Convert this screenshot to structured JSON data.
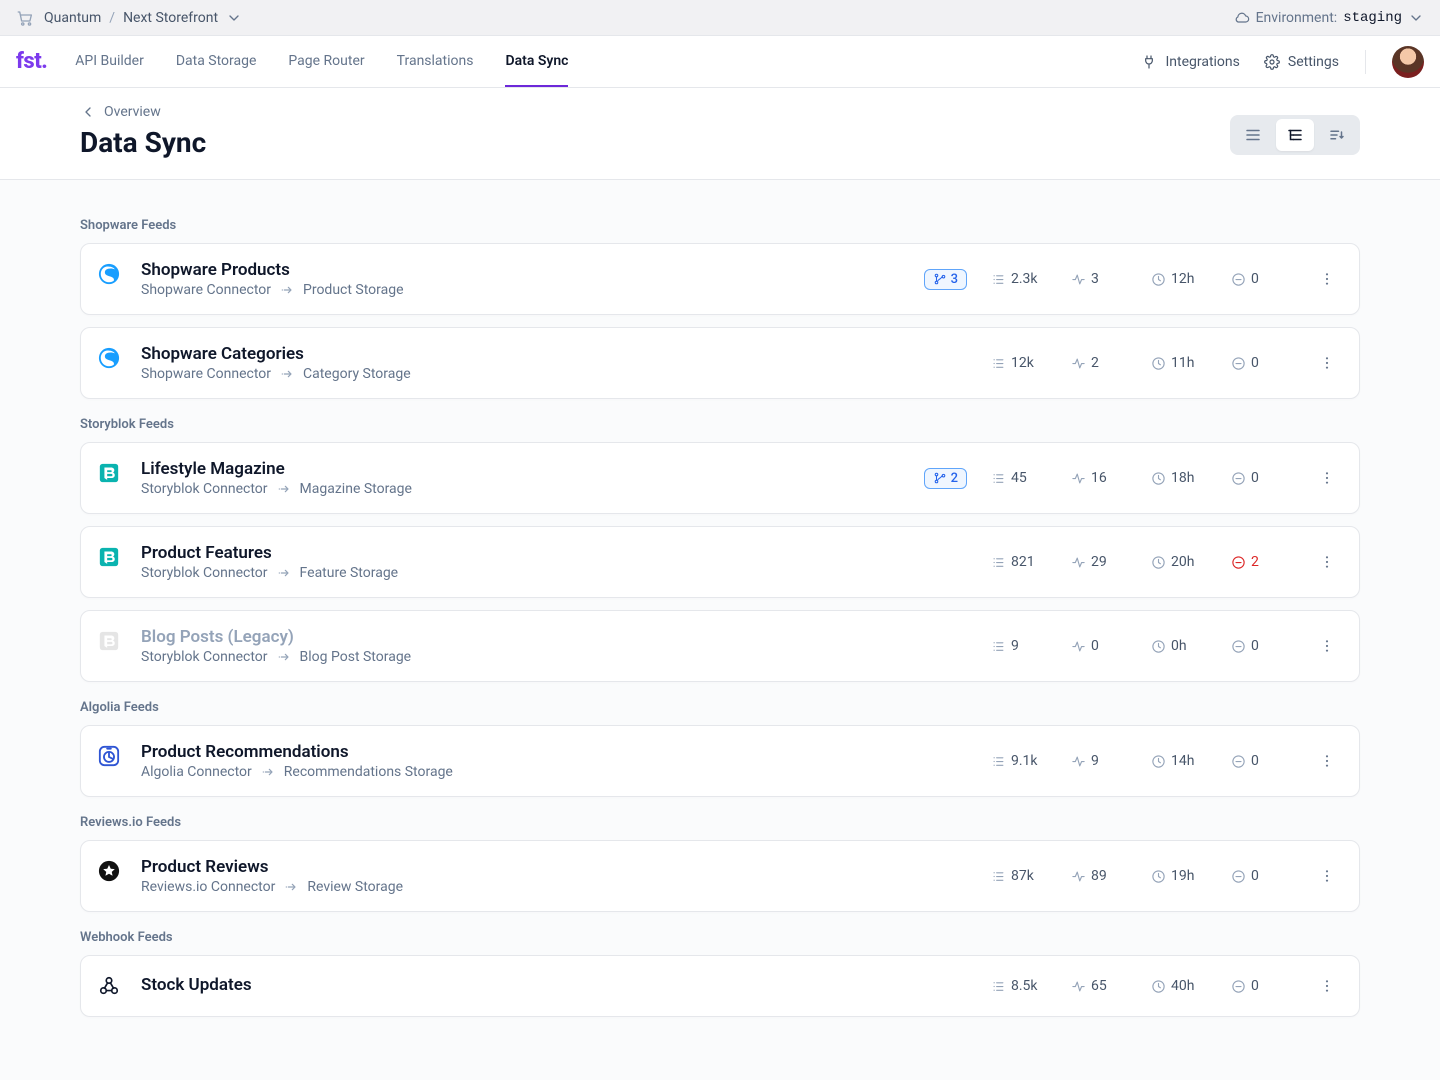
{
  "topbar": {
    "workspace": "Quantum",
    "project": "Next Storefront",
    "env_label": "Environment:",
    "env_value": "staging"
  },
  "nav": {
    "tabs": [
      "API Builder",
      "Data Storage",
      "Page Router",
      "Translations",
      "Data Sync"
    ],
    "active": 4,
    "integrations": "Integrations",
    "settings": "Settings"
  },
  "page": {
    "breadcrumb": "Overview",
    "title": "Data Sync"
  },
  "groups": [
    {
      "title": "Shopware Feeds",
      "items": [
        {
          "icon": "shopware",
          "title": "Shopware Products",
          "src": "Shopware Connector",
          "dst": "Product Storage",
          "badge": "3",
          "records": "2.3k",
          "activity": "3",
          "age": "12h",
          "errors": "0"
        },
        {
          "icon": "shopware",
          "title": "Shopware Categories",
          "src": "Shopware Connector",
          "dst": "Category Storage",
          "badge": null,
          "records": "12k",
          "activity": "2",
          "age": "11h",
          "errors": "0"
        }
      ]
    },
    {
      "title": "Storyblok Feeds",
      "items": [
        {
          "icon": "storyblok",
          "title": "Lifestyle Magazine",
          "src": "Storyblok Connector",
          "dst": "Magazine Storage",
          "badge": "2",
          "records": "45",
          "activity": "16",
          "age": "18h",
          "errors": "0"
        },
        {
          "icon": "storyblok",
          "title": "Product Features",
          "src": "Storyblok Connector",
          "dst": "Feature Storage",
          "badge": null,
          "records": "821",
          "activity": "29",
          "age": "20h",
          "errors": "2",
          "errorDanger": true
        },
        {
          "icon": "storyblok-gray",
          "title": "Blog Posts (Legacy)",
          "src": "Storyblok Connector",
          "dst": "Blog Post Storage",
          "badge": null,
          "records": "9",
          "activity": "0",
          "age": "0h",
          "errors": "0",
          "deprecated": true
        }
      ]
    },
    {
      "title": "Algolia Feeds",
      "items": [
        {
          "icon": "algolia",
          "title": "Product Recommendations",
          "src": "Algolia Connector",
          "dst": "Recommendations Storage",
          "badge": null,
          "records": "9.1k",
          "activity": "9",
          "age": "14h",
          "errors": "0"
        }
      ]
    },
    {
      "title": "Reviews.io Feeds",
      "items": [
        {
          "icon": "reviewsio",
          "title": "Product Reviews",
          "src": "Reviews.io Connector",
          "dst": "Review Storage",
          "badge": null,
          "records": "87k",
          "activity": "89",
          "age": "19h",
          "errors": "0"
        }
      ]
    },
    {
      "title": "Webhook Feeds",
      "items": [
        {
          "icon": "webhook",
          "title": "Stock Updates",
          "src": "",
          "dst": "",
          "badge": null,
          "records": "8.5k",
          "activity": "65",
          "age": "40h",
          "errors": "0"
        }
      ]
    }
  ]
}
